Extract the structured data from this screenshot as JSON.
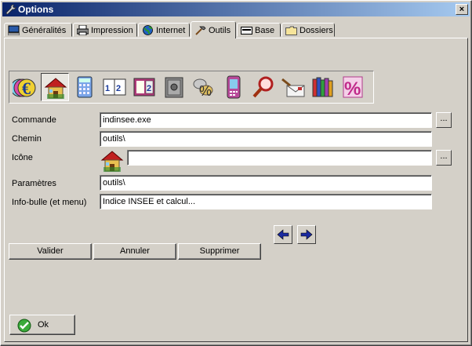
{
  "window": {
    "title": "Options",
    "close_label": "×"
  },
  "tabs": [
    {
      "label": "Généralités",
      "icon": "computer-icon"
    },
    {
      "label": "Impression",
      "icon": "printer-icon"
    },
    {
      "label": "Internet",
      "icon": "globe-icon"
    },
    {
      "label": "Outils",
      "icon": "hammer-icon",
      "active": true
    },
    {
      "label": "Base",
      "icon": "card-icon"
    },
    {
      "label": "Dossiers",
      "icon": "folder-icon"
    }
  ],
  "toolbar": [
    "euro-icon",
    "house-icon",
    "calculator-icon",
    "fraction-book-icon",
    "calculator-icon-2",
    "safe-icon",
    "percent-coins-icon",
    "pda-icon",
    "magnifier-icon",
    "envelope-icon",
    "books-icon",
    "percent-icon"
  ],
  "form": {
    "commande_label": "Commande",
    "commande_value": "indinsee.exe",
    "chemin_label": "Chemin",
    "chemin_value": "outils\\",
    "icone_label": "Icône",
    "icone_value": "",
    "parametres_label": "Paramètres",
    "parametres_value": "outils\\",
    "infobulle_label": "Info-bulle (et menu)",
    "infobulle_value": "Indice INSEE et calcul...",
    "browse_label": "..."
  },
  "buttons": {
    "valider": "Valider",
    "annuler": "Annuler",
    "supprimer": "Supprimer",
    "ok": "Ok"
  },
  "colors": {
    "title_start": "#0a246a",
    "title_end": "#a6caf0",
    "face": "#d4d0c8"
  }
}
